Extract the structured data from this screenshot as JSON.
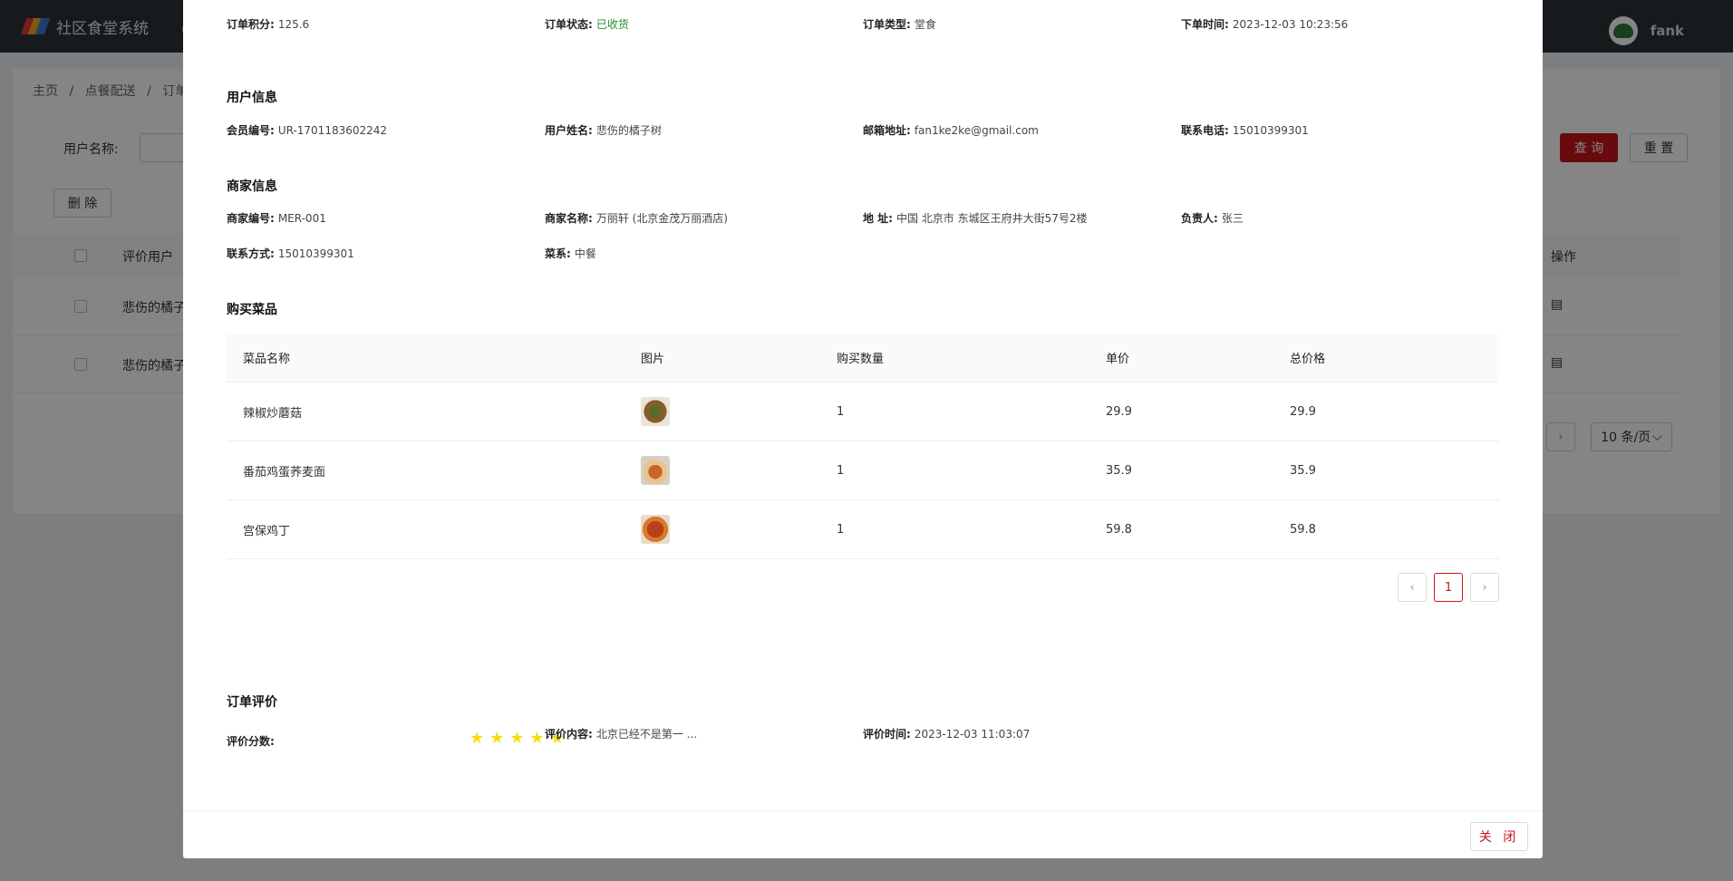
{
  "app": {
    "title": "社区食堂系统",
    "user_name": "fank",
    "breadcrumb": [
      "主页",
      "点餐配送",
      "订单评"
    ],
    "breadcrumb_sep": "/",
    "filter_label": "用户名称:",
    "query_label": "查 询",
    "reset_label": "重 置",
    "delete_label": "删 除",
    "table_col_user": "评价用户",
    "table_col_op": "操作",
    "rows": [
      "悲伤的橘子",
      "悲伤的橘子"
    ],
    "page_size_label": "10 条/页"
  },
  "modal": {
    "order": {
      "points_label": "订单积分:",
      "points": "125.6",
      "status_label": "订单状态:",
      "status": "已收货",
      "type_label": "订单类型:",
      "type": "堂食",
      "time_label": "下单时间:",
      "time": "2023-12-03 10:23:56"
    },
    "user_section_title": "用户信息",
    "user": {
      "id_label": "会员编号:",
      "id": "UR-1701183602242",
      "name_label": "用户姓名:",
      "name": "悲伤的橘子树",
      "email_label": "邮箱地址:",
      "email": "fan1ke2ke@gmail.com",
      "phone_label": "联系电话:",
      "phone": "15010399301"
    },
    "merchant_section_title": "商家信息",
    "merchant": {
      "id_label": "商家编号:",
      "id": "MER-001",
      "name_label": "商家名称:",
      "name": "万丽轩 (北京金茂万丽酒店)",
      "address_label": "地 址:",
      "address": "中国 北京市 东城区王府井大街57号2楼",
      "manager_label": "负责人:",
      "manager": "张三",
      "contact_label": "联系方式:",
      "contact": "15010399301",
      "cuisine_label": "菜系:",
      "cuisine": "中餐"
    },
    "dishes_section_title": "购买菜品",
    "dish_columns": {
      "name": "菜品名称",
      "image": "图片",
      "qty": "购买数量",
      "price": "单价",
      "total": "总价格"
    },
    "dishes": [
      {
        "name": "辣椒炒蘑菇",
        "qty": "1",
        "price": "29.9",
        "total": "29.9"
      },
      {
        "name": "番茄鸡蛋荞麦面",
        "qty": "1",
        "price": "35.9",
        "total": "35.9"
      },
      {
        "name": "宫保鸡丁",
        "qty": "1",
        "price": "59.8",
        "total": "59.8"
      }
    ],
    "current_page": "1",
    "review_section_title": "订单评价",
    "review": {
      "score_label": "评价分数:",
      "score": 5,
      "max_score": 5,
      "content_label": "评价内容:",
      "content": "北京已经不是第一 ...",
      "time_label": "评价时间:",
      "time": "2023-12-03 11:03:07"
    },
    "close_label": "关 闭"
  },
  "colors": {
    "accent": "#c9151e",
    "status_green": "#2a8a2a",
    "star": "#fadb14",
    "topbar": "#2b3338"
  }
}
